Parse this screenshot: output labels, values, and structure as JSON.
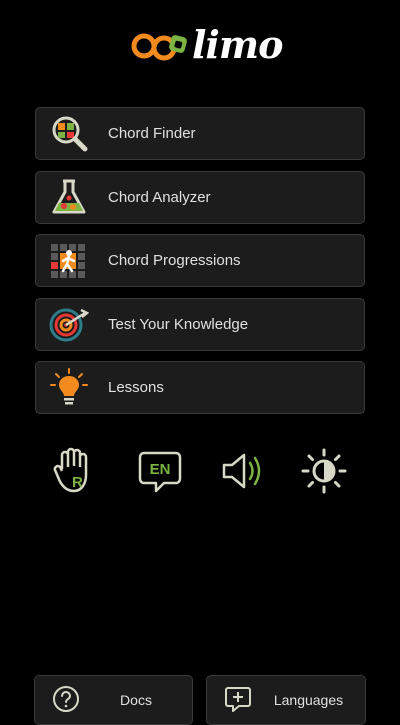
{
  "app": {
    "logo_text": "limo"
  },
  "colors": {
    "background": "#000000",
    "button_bg": "#1c1c1c",
    "button_border": "#3a3a3a",
    "accent_orange": "#f28a1e",
    "accent_green": "#7cb342",
    "accent_red": "#e53935",
    "icon_light": "#d8d8c8"
  },
  "menu": {
    "items": [
      {
        "label": "Chord Finder",
        "icon": "chord-finder-icon"
      },
      {
        "label": "Chord Analyzer",
        "icon": "flask-icon"
      },
      {
        "label": "Chord Progressions",
        "icon": "progression-grid-icon"
      },
      {
        "label": "Test Your Knowledge",
        "icon": "target-icon"
      },
      {
        "label": "Lessons",
        "icon": "lightbulb-icon"
      }
    ]
  },
  "tools": {
    "hand_icon_letter": "R",
    "language_code": "EN",
    "items": [
      {
        "icon": "hand-right-icon"
      },
      {
        "icon": "language-icon"
      },
      {
        "icon": "speaker-icon"
      },
      {
        "icon": "brightness-icon"
      }
    ]
  },
  "footer": {
    "docs_label": "Docs",
    "languages_label": "Languages",
    "docs_icon": "question-icon",
    "languages_icon": "speech-plus-icon"
  }
}
